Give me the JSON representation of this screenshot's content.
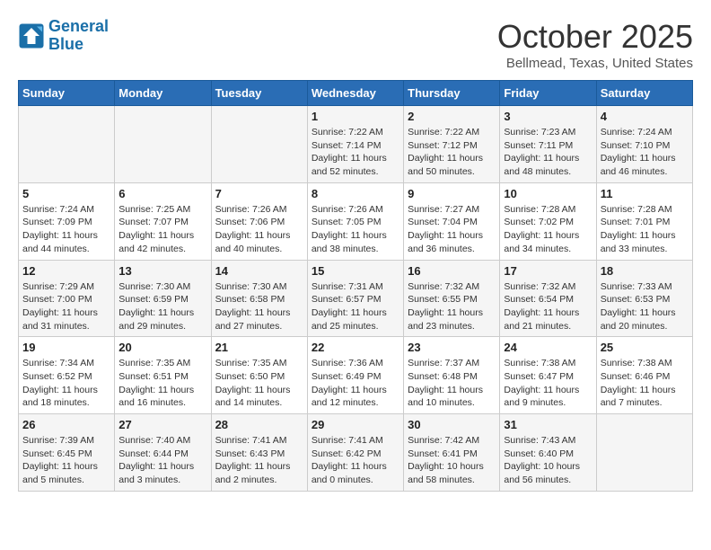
{
  "header": {
    "logo_line1": "General",
    "logo_line2": "Blue",
    "month": "October 2025",
    "location": "Bellmead, Texas, United States"
  },
  "days_of_week": [
    "Sunday",
    "Monday",
    "Tuesday",
    "Wednesday",
    "Thursday",
    "Friday",
    "Saturday"
  ],
  "weeks": [
    [
      {
        "num": "",
        "info": ""
      },
      {
        "num": "",
        "info": ""
      },
      {
        "num": "",
        "info": ""
      },
      {
        "num": "1",
        "info": "Sunrise: 7:22 AM\nSunset: 7:14 PM\nDaylight: 11 hours and 52 minutes."
      },
      {
        "num": "2",
        "info": "Sunrise: 7:22 AM\nSunset: 7:12 PM\nDaylight: 11 hours and 50 minutes."
      },
      {
        "num": "3",
        "info": "Sunrise: 7:23 AM\nSunset: 7:11 PM\nDaylight: 11 hours and 48 minutes."
      },
      {
        "num": "4",
        "info": "Sunrise: 7:24 AM\nSunset: 7:10 PM\nDaylight: 11 hours and 46 minutes."
      }
    ],
    [
      {
        "num": "5",
        "info": "Sunrise: 7:24 AM\nSunset: 7:09 PM\nDaylight: 11 hours and 44 minutes."
      },
      {
        "num": "6",
        "info": "Sunrise: 7:25 AM\nSunset: 7:07 PM\nDaylight: 11 hours and 42 minutes."
      },
      {
        "num": "7",
        "info": "Sunrise: 7:26 AM\nSunset: 7:06 PM\nDaylight: 11 hours and 40 minutes."
      },
      {
        "num": "8",
        "info": "Sunrise: 7:26 AM\nSunset: 7:05 PM\nDaylight: 11 hours and 38 minutes."
      },
      {
        "num": "9",
        "info": "Sunrise: 7:27 AM\nSunset: 7:04 PM\nDaylight: 11 hours and 36 minutes."
      },
      {
        "num": "10",
        "info": "Sunrise: 7:28 AM\nSunset: 7:02 PM\nDaylight: 11 hours and 34 minutes."
      },
      {
        "num": "11",
        "info": "Sunrise: 7:28 AM\nSunset: 7:01 PM\nDaylight: 11 hours and 33 minutes."
      }
    ],
    [
      {
        "num": "12",
        "info": "Sunrise: 7:29 AM\nSunset: 7:00 PM\nDaylight: 11 hours and 31 minutes."
      },
      {
        "num": "13",
        "info": "Sunrise: 7:30 AM\nSunset: 6:59 PM\nDaylight: 11 hours and 29 minutes."
      },
      {
        "num": "14",
        "info": "Sunrise: 7:30 AM\nSunset: 6:58 PM\nDaylight: 11 hours and 27 minutes."
      },
      {
        "num": "15",
        "info": "Sunrise: 7:31 AM\nSunset: 6:57 PM\nDaylight: 11 hours and 25 minutes."
      },
      {
        "num": "16",
        "info": "Sunrise: 7:32 AM\nSunset: 6:55 PM\nDaylight: 11 hours and 23 minutes."
      },
      {
        "num": "17",
        "info": "Sunrise: 7:32 AM\nSunset: 6:54 PM\nDaylight: 11 hours and 21 minutes."
      },
      {
        "num": "18",
        "info": "Sunrise: 7:33 AM\nSunset: 6:53 PM\nDaylight: 11 hours and 20 minutes."
      }
    ],
    [
      {
        "num": "19",
        "info": "Sunrise: 7:34 AM\nSunset: 6:52 PM\nDaylight: 11 hours and 18 minutes."
      },
      {
        "num": "20",
        "info": "Sunrise: 7:35 AM\nSunset: 6:51 PM\nDaylight: 11 hours and 16 minutes."
      },
      {
        "num": "21",
        "info": "Sunrise: 7:35 AM\nSunset: 6:50 PM\nDaylight: 11 hours and 14 minutes."
      },
      {
        "num": "22",
        "info": "Sunrise: 7:36 AM\nSunset: 6:49 PM\nDaylight: 11 hours and 12 minutes."
      },
      {
        "num": "23",
        "info": "Sunrise: 7:37 AM\nSunset: 6:48 PM\nDaylight: 11 hours and 10 minutes."
      },
      {
        "num": "24",
        "info": "Sunrise: 7:38 AM\nSunset: 6:47 PM\nDaylight: 11 hours and 9 minutes."
      },
      {
        "num": "25",
        "info": "Sunrise: 7:38 AM\nSunset: 6:46 PM\nDaylight: 11 hours and 7 minutes."
      }
    ],
    [
      {
        "num": "26",
        "info": "Sunrise: 7:39 AM\nSunset: 6:45 PM\nDaylight: 11 hours and 5 minutes."
      },
      {
        "num": "27",
        "info": "Sunrise: 7:40 AM\nSunset: 6:44 PM\nDaylight: 11 hours and 3 minutes."
      },
      {
        "num": "28",
        "info": "Sunrise: 7:41 AM\nSunset: 6:43 PM\nDaylight: 11 hours and 2 minutes."
      },
      {
        "num": "29",
        "info": "Sunrise: 7:41 AM\nSunset: 6:42 PM\nDaylight: 11 hours and 0 minutes."
      },
      {
        "num": "30",
        "info": "Sunrise: 7:42 AM\nSunset: 6:41 PM\nDaylight: 10 hours and 58 minutes."
      },
      {
        "num": "31",
        "info": "Sunrise: 7:43 AM\nSunset: 6:40 PM\nDaylight: 10 hours and 56 minutes."
      },
      {
        "num": "",
        "info": ""
      }
    ]
  ]
}
